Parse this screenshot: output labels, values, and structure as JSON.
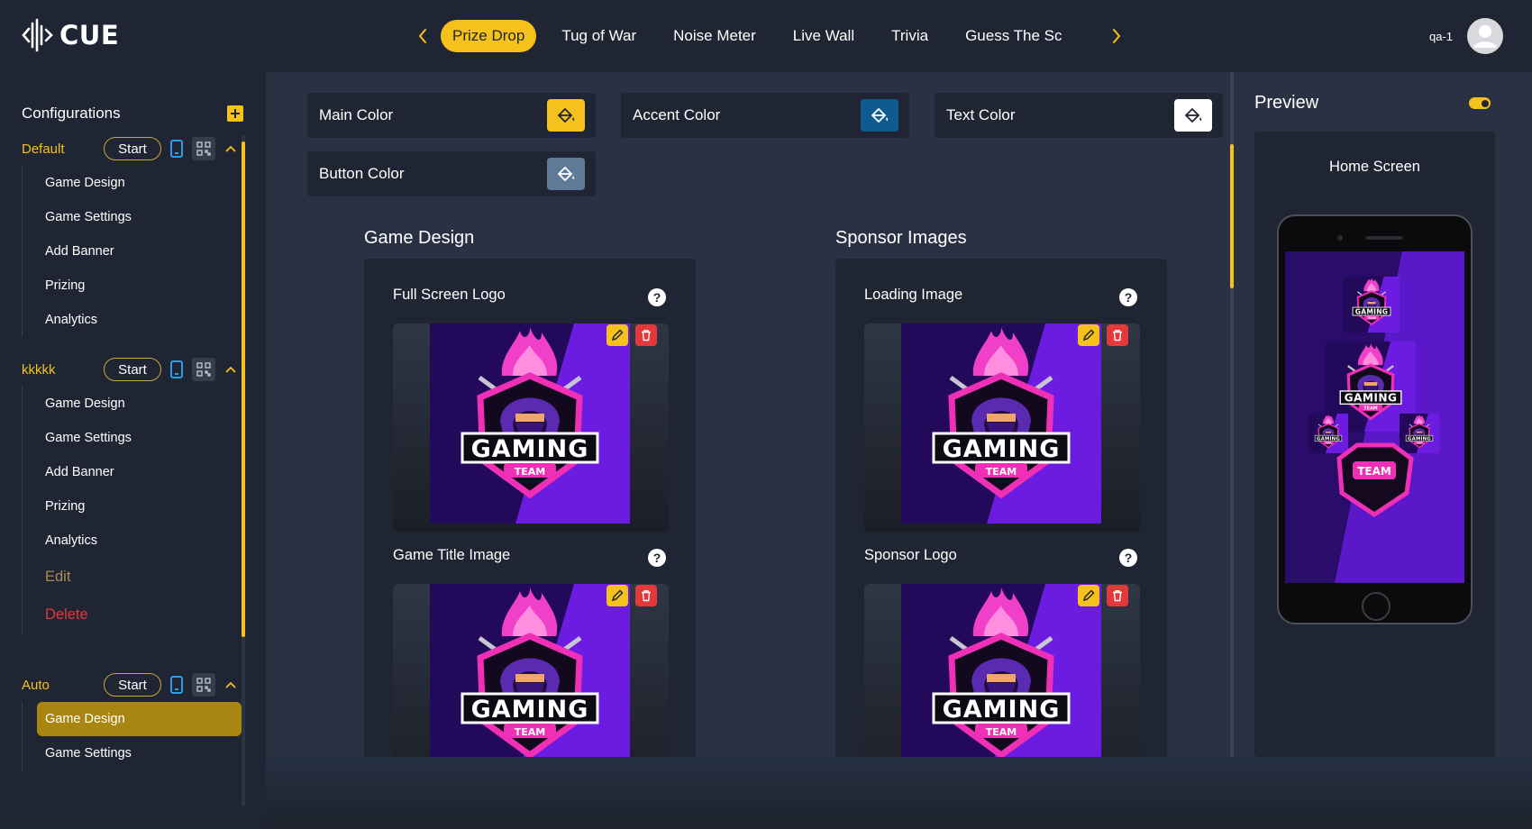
{
  "app": {
    "brand": "CUE",
    "user_name": "qa-1"
  },
  "nav": {
    "tabs": [
      {
        "label": "Prize Drop",
        "active": true
      },
      {
        "label": "Tug of War"
      },
      {
        "label": "Noise Meter"
      },
      {
        "label": "Live Wall"
      },
      {
        "label": "Trivia"
      },
      {
        "label": "Guess The Sc"
      }
    ]
  },
  "sidebar": {
    "title": "Configurations",
    "configs": [
      {
        "name": "Default",
        "start_label": "Start",
        "items": [
          "Game Design",
          "Game Settings",
          "Add Banner",
          "Prizing",
          "Analytics"
        ]
      },
      {
        "name": "kkkkk",
        "start_label": "Start",
        "items": [
          "Game Design",
          "Game Settings",
          "Add Banner",
          "Prizing",
          "Analytics"
        ],
        "edit_label": "Edit",
        "delete_label": "Delete"
      },
      {
        "name": "Auto",
        "start_label": "Start",
        "items": [
          "Game Design",
          "Game Settings"
        ],
        "active_item": "Game Design"
      }
    ]
  },
  "colors": {
    "main": {
      "label": "Main Color",
      "value": "#f4c21b"
    },
    "accent": {
      "label": "Accent Color",
      "value": "#0f5a8e"
    },
    "text": {
      "label": "Text Color",
      "value": "#ffffff"
    },
    "button": {
      "label": "Button Color",
      "value": "#5e7a96"
    }
  },
  "game_design": {
    "title": "Game Design",
    "images": [
      {
        "label": "Full Screen Logo"
      },
      {
        "label": "Game Title Image"
      }
    ]
  },
  "sponsor_images": {
    "title": "Sponsor Images",
    "images": [
      {
        "label": "Loading Image"
      },
      {
        "label": "Sponsor Logo"
      }
    ]
  },
  "logo_art": {
    "word": "GAMING",
    "sub": "TEAM"
  },
  "preview": {
    "title": "Preview",
    "screen_label": "Home Screen",
    "enabled": true
  },
  "icons": {
    "help": "?",
    "nav_prev": "chevron-left-icon",
    "nav_next": "chevron-right-icon",
    "swatch": "paint-bucket-icon",
    "edit": "pencil-icon",
    "delete": "trash-icon",
    "device": "phone-icon",
    "qr": "qr-code-icon",
    "collapse": "chevron-up-icon"
  },
  "theme": {
    "accent": "#f4c21b",
    "bg": "#1f2532",
    "panel": "#293143",
    "danger": "#e5383b"
  }
}
